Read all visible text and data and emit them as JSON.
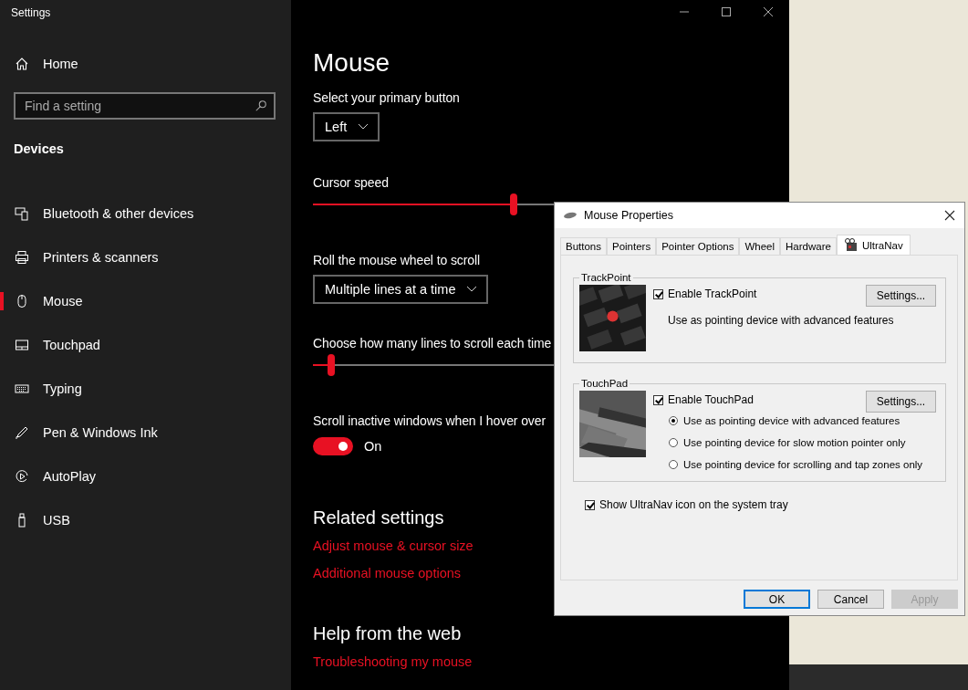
{
  "window": {
    "title": "Settings"
  },
  "sidebar": {
    "home": "Home",
    "search": {
      "placeholder": "Find a setting"
    },
    "section": "Devices",
    "items": [
      {
        "label": "Bluetooth & other devices",
        "selected": false
      },
      {
        "label": "Printers & scanners",
        "selected": false
      },
      {
        "label": "Mouse",
        "selected": true
      },
      {
        "label": "Touchpad",
        "selected": false
      },
      {
        "label": "Typing",
        "selected": false
      },
      {
        "label": "Pen & Windows Ink",
        "selected": false
      },
      {
        "label": "AutoPlay",
        "selected": false
      },
      {
        "label": "USB",
        "selected": false
      }
    ]
  },
  "main": {
    "title": "Mouse",
    "primary_button": {
      "label": "Select your primary button",
      "value": "Left"
    },
    "cursor_speed": {
      "label": "Cursor speed",
      "level": 0.44
    },
    "wheel": {
      "label": "Roll the mouse wheel to scroll",
      "value": "Multiple lines at a time"
    },
    "lines": {
      "label": "Choose how many lines to scroll each time",
      "level": 0.04
    },
    "inactive": {
      "label": "Scroll inactive windows when I hover over",
      "on": true,
      "state": "On"
    },
    "related": {
      "heading": "Related settings",
      "links": [
        "Adjust mouse & cursor size",
        "Additional mouse options"
      ]
    },
    "help": {
      "heading": "Help from the web",
      "links": [
        "Troubleshooting my mouse"
      ]
    }
  },
  "dialog": {
    "title": "Mouse Properties",
    "tabs": [
      {
        "label": "Buttons",
        "selected": false
      },
      {
        "label": "Pointers",
        "selected": false
      },
      {
        "label": "Pointer Options",
        "selected": false
      },
      {
        "label": "Wheel",
        "selected": false
      },
      {
        "label": "Hardware",
        "selected": false
      },
      {
        "label": "UltraNav",
        "selected": true
      }
    ],
    "groups": [
      {
        "title": "TrackPoint",
        "enable": {
          "label": "Enable TrackPoint",
          "checked": true
        },
        "button": "Settings...",
        "note": "Use as pointing device with advanced features"
      },
      {
        "title": "TouchPad",
        "enable": {
          "label": "Enable TouchPad",
          "checked": true
        },
        "button": "Settings...",
        "options": [
          {
            "label": "Use as pointing device with advanced features",
            "selected": true
          },
          {
            "label": "Use pointing device for slow motion pointer only",
            "selected": false
          },
          {
            "label": "Use pointing device for scrolling and tap zones only",
            "selected": false
          }
        ]
      }
    ],
    "tray": {
      "label": "Show UltraNav icon on the system tray",
      "checked": true
    },
    "buttons": [
      {
        "label": "OK",
        "default": true,
        "disabled": false
      },
      {
        "label": "Cancel",
        "default": false,
        "disabled": false
      },
      {
        "label": "Apply",
        "default": false,
        "disabled": true
      }
    ]
  }
}
